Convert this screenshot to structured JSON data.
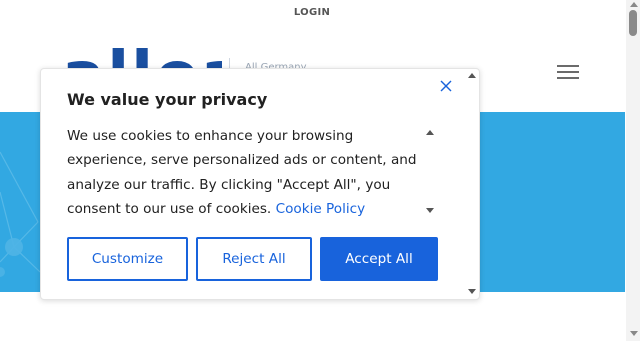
{
  "header": {
    "login_label": "LOGIN",
    "logo_text": "alloa",
    "logo_sub": "All Germany"
  },
  "consent": {
    "title": "We value your privacy",
    "body": "We use cookies to enhance your browsing experience, serve personalized ads or content, and analyze our traffic. By clicking \"Accept All\", you consent to our use of cookies.",
    "policy_link": "Cookie Policy",
    "buttons": {
      "customize": "Customize",
      "reject": "Reject All",
      "accept": "Accept All"
    }
  },
  "colors": {
    "brand": "#1863dc",
    "hero": "#32a8e2",
    "logo": "#1a4fa0"
  },
  "icons": {
    "close": "close-icon",
    "menu": "hamburger-icon"
  }
}
